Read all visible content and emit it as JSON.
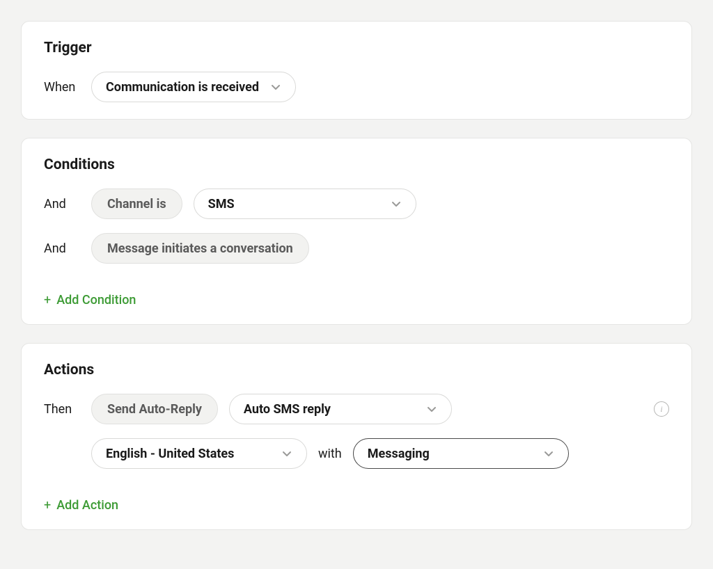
{
  "trigger": {
    "heading": "Trigger",
    "prefix": "When",
    "event": "Communication is received"
  },
  "conditions": {
    "heading": "Conditions",
    "items": [
      {
        "prefix": "And",
        "type": "Channel is",
        "value": "SMS"
      },
      {
        "prefix": "And",
        "type": "Message initiates a conversation"
      }
    ],
    "add_label": "Add Condition"
  },
  "actions": {
    "heading": "Actions",
    "prefix": "Then",
    "type": "Send Auto-Reply",
    "template": "Auto SMS reply",
    "language": "English - United States",
    "connector": "with",
    "channel": "Messaging",
    "add_label": "Add Action"
  }
}
